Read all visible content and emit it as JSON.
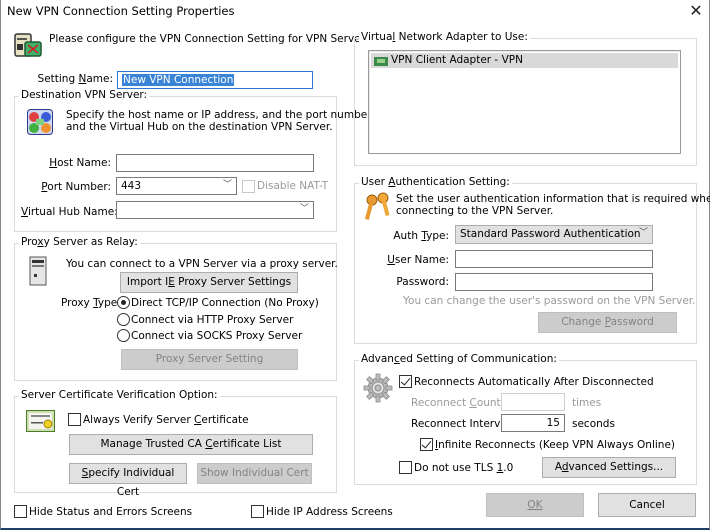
{
  "window": {
    "title": "New VPN Connection Setting Properties",
    "close_icon": "close-icon"
  },
  "intro": {
    "text": "Please configure the VPN Connection Setting for VPN Server.",
    "icon": "vpn-server-icon"
  },
  "setting_name": {
    "label": "Setting Name:",
    "value": "New VPN Connection"
  },
  "destination": {
    "group_label": "Destination VPN Server:",
    "icon": "network-hub-icon",
    "description_line1": "Specify the host name or IP address, and the port number",
    "description_line2": "and the Virtual Hub on the destination VPN Server.",
    "host_label": "Host Name:",
    "host_value": "",
    "port_label": "Port Number:",
    "port_value": "443",
    "disable_natt_label": "Disable NAT-T",
    "disable_natt_checked": false,
    "hub_label": "Virtual Hub Name:",
    "hub_value": ""
  },
  "proxy": {
    "group_label": "Proxy Server as Relay:",
    "icon": "computer-tower-icon",
    "description": "You can connect to a VPN Server via a proxy server.",
    "import_button": "Import IE Proxy Server Settings",
    "type_label": "Proxy Type:",
    "options": [
      {
        "label": "Direct TCP/IP Connection (No Proxy)",
        "selected": true
      },
      {
        "label": "Connect via HTTP Proxy Server",
        "selected": false
      },
      {
        "label": "Connect via SOCKS Proxy Server",
        "selected": false
      }
    ],
    "setting_button": "Proxy Server Setting"
  },
  "certificate": {
    "group_label": "Server Certificate Verification Option:",
    "icon": "certificate-icon",
    "always_verify_label": "Always Verify Server Certificate",
    "always_verify_checked": false,
    "manage_ca_button": "Manage Trusted CA Certificate List",
    "specify_cert_button": "Specify Individual Cert",
    "show_cert_button": "Show Individual Cert"
  },
  "bottom": {
    "hide_status_label": "Hide Status and Errors Screens",
    "hide_status_checked": false,
    "hide_ip_label": "Hide IP Address Screens",
    "hide_ip_checked": false,
    "ok_button": "OK",
    "cancel_button": "Cancel"
  },
  "adapter": {
    "group_label": "Virtual Network Adapter to Use:",
    "items": [
      {
        "label": "VPN Client Adapter - VPN",
        "icon": "network-adapter-icon",
        "selected": true
      }
    ]
  },
  "auth": {
    "group_label": "User Authentication Setting:",
    "icon": "keys-icon",
    "description_line1": "Set the user authentication information that is required when",
    "description_line2": "connecting to the VPN Server.",
    "auth_type_label": "Auth Type:",
    "auth_type_value": "Standard Password Authentication",
    "username_label": "User Name:",
    "username_value": "",
    "password_label": "Password:",
    "password_value": "",
    "hint": "You can change the user's password on the VPN Server.",
    "change_password_button": "Change Password"
  },
  "advanced": {
    "group_label": "Advanced Setting of Communication:",
    "icon": "gear-icon",
    "reconnect_label": "Reconnects Automatically After Disconnected",
    "reconnect_checked": true,
    "count_label": "Reconnect Count:",
    "count_value": "",
    "count_unit": "times",
    "interval_label": "Reconnect Interval:",
    "interval_value": "15",
    "interval_unit": "seconds",
    "infinite_label": "Infinite Reconnects (Keep VPN Always Online)",
    "infinite_checked": true,
    "no_tls_label": "Do not use TLS 1.0",
    "no_tls_checked": false,
    "advanced_button": "Advanced Settings..."
  }
}
